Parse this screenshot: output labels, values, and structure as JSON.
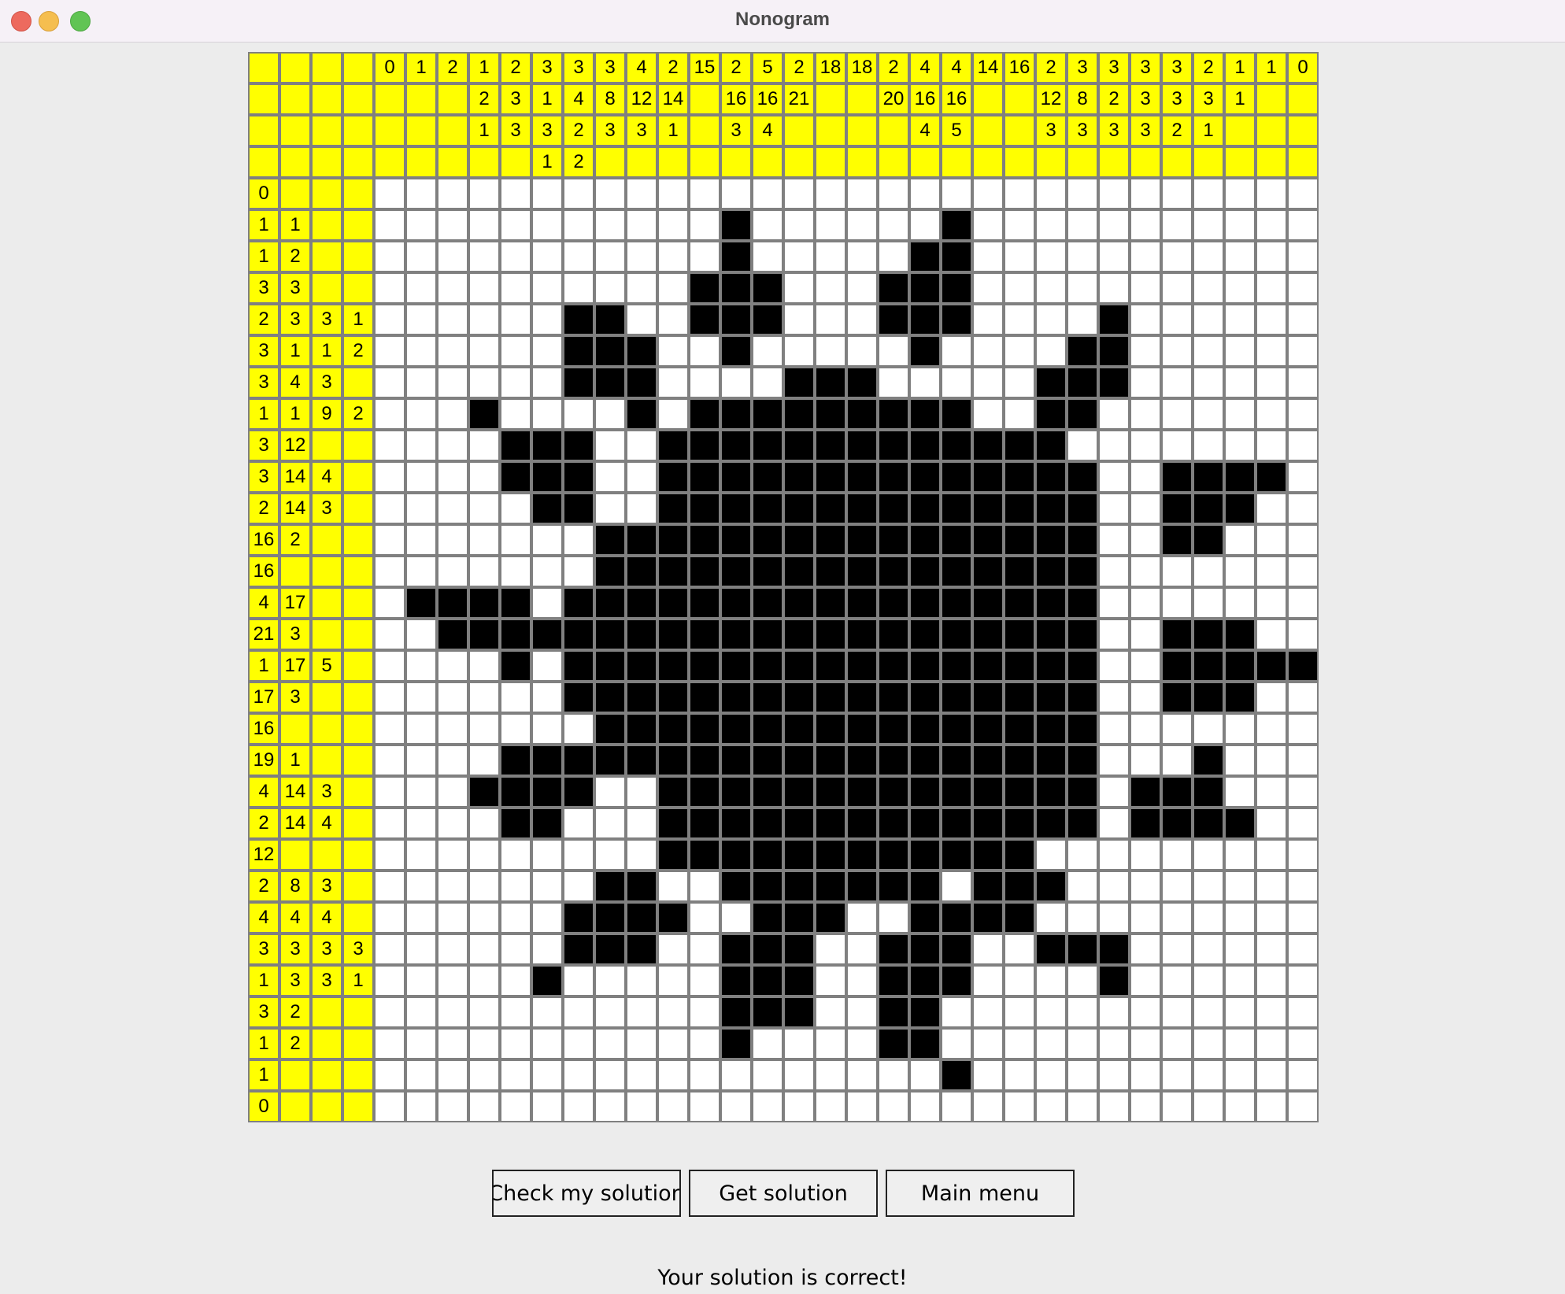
{
  "window": {
    "title": "Nonogram"
  },
  "puzzle": {
    "size": 29,
    "clue_depth_rows": 4,
    "clue_depth_cols": 4,
    "column_clues": [
      [
        "0"
      ],
      [
        "1"
      ],
      [
        "2"
      ],
      [
        "1",
        "2",
        "1"
      ],
      [
        "2",
        "3",
        "3"
      ],
      [
        "3",
        "1",
        "3",
        "1"
      ],
      [
        "3",
        "4",
        "2",
        "2"
      ],
      [
        "3",
        "8",
        "3"
      ],
      [
        "4",
        "12",
        "3"
      ],
      [
        "2",
        "14",
        "1"
      ],
      [
        "15"
      ],
      [
        "2",
        "16",
        "3"
      ],
      [
        "5",
        "16",
        "4"
      ],
      [
        "2",
        "21"
      ],
      [
        "18"
      ],
      [
        "18"
      ],
      [
        "2",
        "20"
      ],
      [
        "4",
        "16",
        "4"
      ],
      [
        "4",
        "16",
        "5"
      ],
      [
        "14"
      ],
      [
        "16"
      ],
      [
        "2",
        "12",
        "3"
      ],
      [
        "3",
        "8",
        "3"
      ],
      [
        "3",
        "2",
        "3"
      ],
      [
        "3",
        "3",
        "3"
      ],
      [
        "3",
        "3",
        "2"
      ],
      [
        "2",
        "3",
        "1"
      ],
      [
        "1",
        "1"
      ],
      [
        "1"
      ],
      [
        "0"
      ]
    ],
    "row_clues": [
      [
        "0"
      ],
      [
        "1",
        "1"
      ],
      [
        "1",
        "2"
      ],
      [
        "3",
        "3"
      ],
      [
        "2",
        "3",
        "3",
        "1"
      ],
      [
        "3",
        "1",
        "1",
        "2"
      ],
      [
        "3",
        "4",
        "3"
      ],
      [
        "1",
        "1",
        "9",
        "2"
      ],
      [
        "3",
        "12"
      ],
      [
        "3",
        "14",
        "4"
      ],
      [
        "2",
        "14",
        "3"
      ],
      [
        "16",
        "2"
      ],
      [
        "16"
      ],
      [
        "4",
        "17"
      ],
      [
        "21",
        "3"
      ],
      [
        "1",
        "17",
        "5"
      ],
      [
        "17",
        "3"
      ],
      [
        "16"
      ],
      [
        "19",
        "1"
      ],
      [
        "4",
        "14",
        "3"
      ],
      [
        "2",
        "14",
        "4"
      ],
      [
        "12"
      ],
      [
        "2",
        "8",
        "3"
      ],
      [
        "4",
        "4",
        "4"
      ],
      [
        "3",
        "3",
        "3",
        "3"
      ],
      [
        "1",
        "3",
        "3",
        "1"
      ],
      [
        "3",
        "2"
      ],
      [
        "1",
        "2"
      ],
      [
        "1"
      ],
      [
        "0"
      ]
    ],
    "solution_rows": [
      ".............................",
      "...........#......#..........",
      "...........#.....##..........",
      "..........###...###..........",
      "......##..###...###....#.....",
      "......###..#.....#....##.....",
      "......###....###.....###.....",
      "...#....#.#########..##......",
      "....###..#############.......",
      "....###..##############..####",
      ".....##..##############..###.",
      ".......################..##..",
      ".......################......",
      ".####.#################......",
      "..#####################..###.",
      "....#.#################..#####",
      "......#################..###.",
      ".......################......",
      "....###################...#..",
      "...####..##############.###..",
      "....##...##############.####.",
      ".........############........",
      ".......##..#######.###.......",
      "......####..###..####........",
      "......###..###..###..###.....",
      ".....#.....###..###....#.....",
      "...........###..##...........",
      "...........#....##...........",
      "..................#..........",
      "............................."
    ]
  },
  "buttons": {
    "check": "Check my solution",
    "get": "Get solution",
    "menu": "Main menu"
  },
  "status": "Your solution is correct!",
  "colors": {
    "clue_bg": "#ffff00",
    "filled": "#000000",
    "empty": "#ffffff",
    "grid_line": "#808080"
  }
}
